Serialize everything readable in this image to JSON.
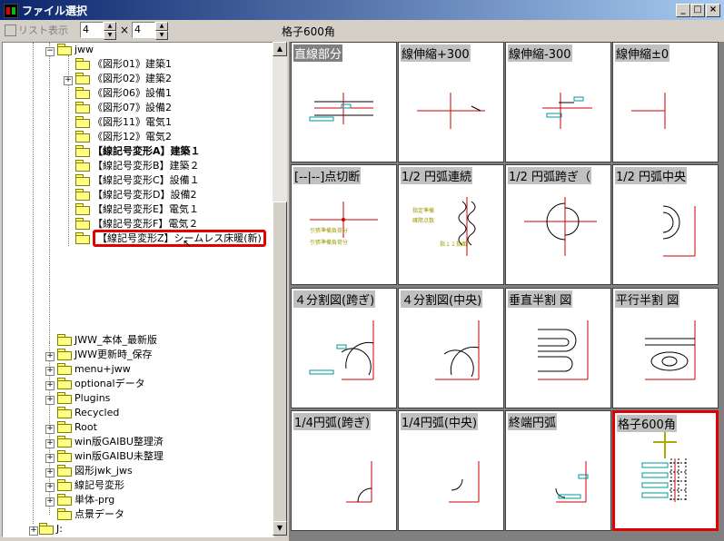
{
  "window": {
    "title": "ファイル選択"
  },
  "toolbar": {
    "list_display_label": "リスト表示",
    "cols_value": "4",
    "rows_value": "4",
    "times": "×",
    "current_name": "格子600角"
  },
  "tree": {
    "items": [
      {
        "label": "jww"
      },
      {
        "label": "《図形01》建築1"
      },
      {
        "label": "《図形02》建築2"
      },
      {
        "label": "《図形06》設備1"
      },
      {
        "label": "《図形07》設備2"
      },
      {
        "label": "《図形11》電気1"
      },
      {
        "label": "《図形12》電気2"
      },
      {
        "label": "【線記号変形A】建築１"
      },
      {
        "label": "【線記号変形B】建築２"
      },
      {
        "label": "【線記号変形C】設備１"
      },
      {
        "label": "【線記号変形D】設備2"
      },
      {
        "label": "【線記号変形E】電気１"
      },
      {
        "label": "【線記号変形F】電気２"
      },
      {
        "label": "【線記号変形Z】シームレス床暖(新)"
      },
      {
        "label": "JWW_本体_最新版"
      },
      {
        "label": "JWW更新時_保存"
      },
      {
        "label": "menu+jww"
      },
      {
        "label": "optionalデータ"
      },
      {
        "label": "Plugins"
      },
      {
        "label": "Recycled"
      },
      {
        "label": "Root"
      },
      {
        "label": "win版GAIBU整理済"
      },
      {
        "label": "win版GAIBU未整理"
      },
      {
        "label": "図形jwk_jws"
      },
      {
        "label": "線記号変形"
      },
      {
        "label": "単体-prg"
      },
      {
        "label": "点景データ"
      },
      {
        "label": "J:"
      }
    ]
  },
  "grid": {
    "cells": [
      {
        "label": "直線部分"
      },
      {
        "label": "線伸縮+300"
      },
      {
        "label": "線伸縮-300"
      },
      {
        "label": "線伸縮±0"
      },
      {
        "label": "[--|--]点切断"
      },
      {
        "label": "1/2 円弧連続"
      },
      {
        "label": "1/2 円弧跨ぎ（"
      },
      {
        "label": "1/2 円弧中央"
      },
      {
        "label": "４分割図(跨ぎ)"
      },
      {
        "label": "４分割図(中央)"
      },
      {
        "label": "垂直半割 図"
      },
      {
        "label": "平行半割 図"
      },
      {
        "label": "1/4円弧(跨ぎ)"
      },
      {
        "label": "1/4円弧(中央)"
      },
      {
        "label": "終端円弧"
      },
      {
        "label": "格子600角"
      }
    ],
    "small_texts": {
      "c5a": "引張準備負荷分",
      "c5b": "引張準備負荷分",
      "c6a": "指定準備",
      "c6b": "確際点数",
      "c6c": "指１１指面"
    }
  },
  "colors": {
    "accent": "#e00000",
    "line": "#cc0000",
    "cyan": "#009999",
    "yellow": "#aaaa00"
  }
}
